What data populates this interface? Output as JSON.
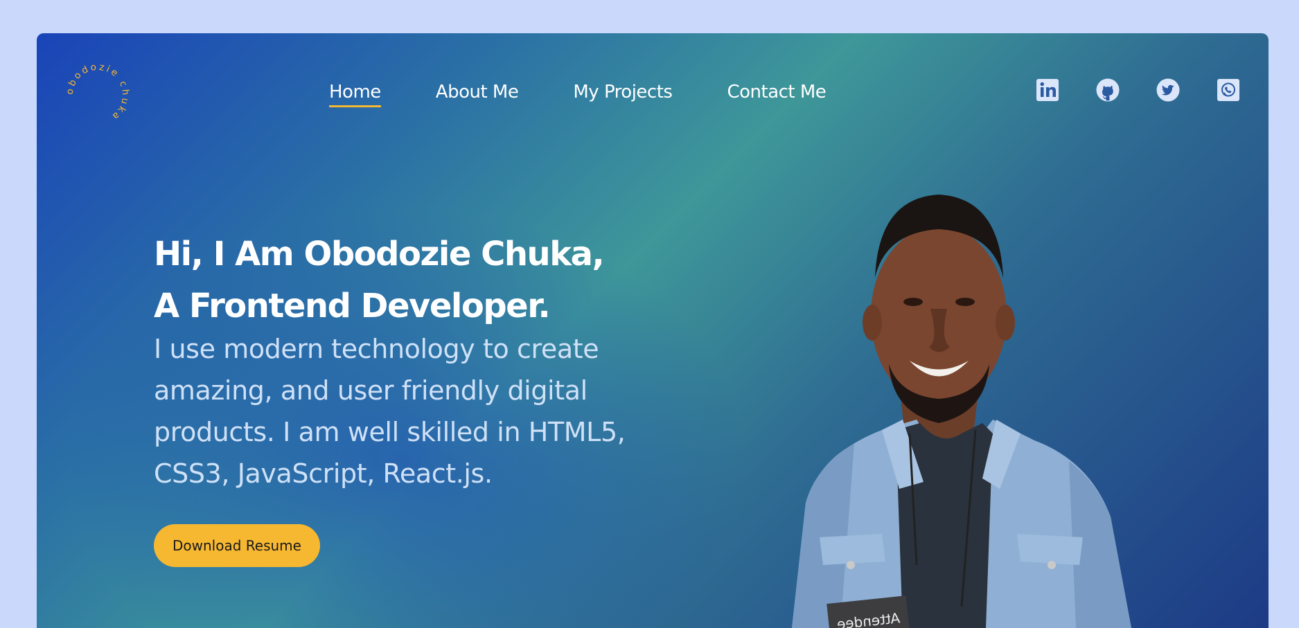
{
  "logo": {
    "text": "obodozie chuka "
  },
  "nav": {
    "items": [
      {
        "label": "Home",
        "active": true
      },
      {
        "label": "About Me"
      },
      {
        "label": "My Projects"
      },
      {
        "label": "Contact Me"
      }
    ]
  },
  "socials": [
    {
      "icon": "linkedin-icon"
    },
    {
      "icon": "github-icon"
    },
    {
      "icon": "twitter-icon"
    },
    {
      "icon": "whatsapp-icon"
    }
  ],
  "hero": {
    "headline_line1": "Hi, I Am Obodozie Chuka,",
    "headline_line2": "A Frontend Developer.",
    "description": "I use modern technology to create amazing, and user friendly digital products. I am well skilled in HTML5, CSS3, JavaScript, React.js.",
    "button_label": "Download Resume"
  },
  "portrait": {
    "badge_text": "Attendee"
  },
  "colors": {
    "page_bg": "#cad9fb",
    "accent": "#f6b731",
    "gradient_start": "#1a44b8",
    "gradient_mid": "#3e9799",
    "gradient_end": "#1d3b86"
  }
}
